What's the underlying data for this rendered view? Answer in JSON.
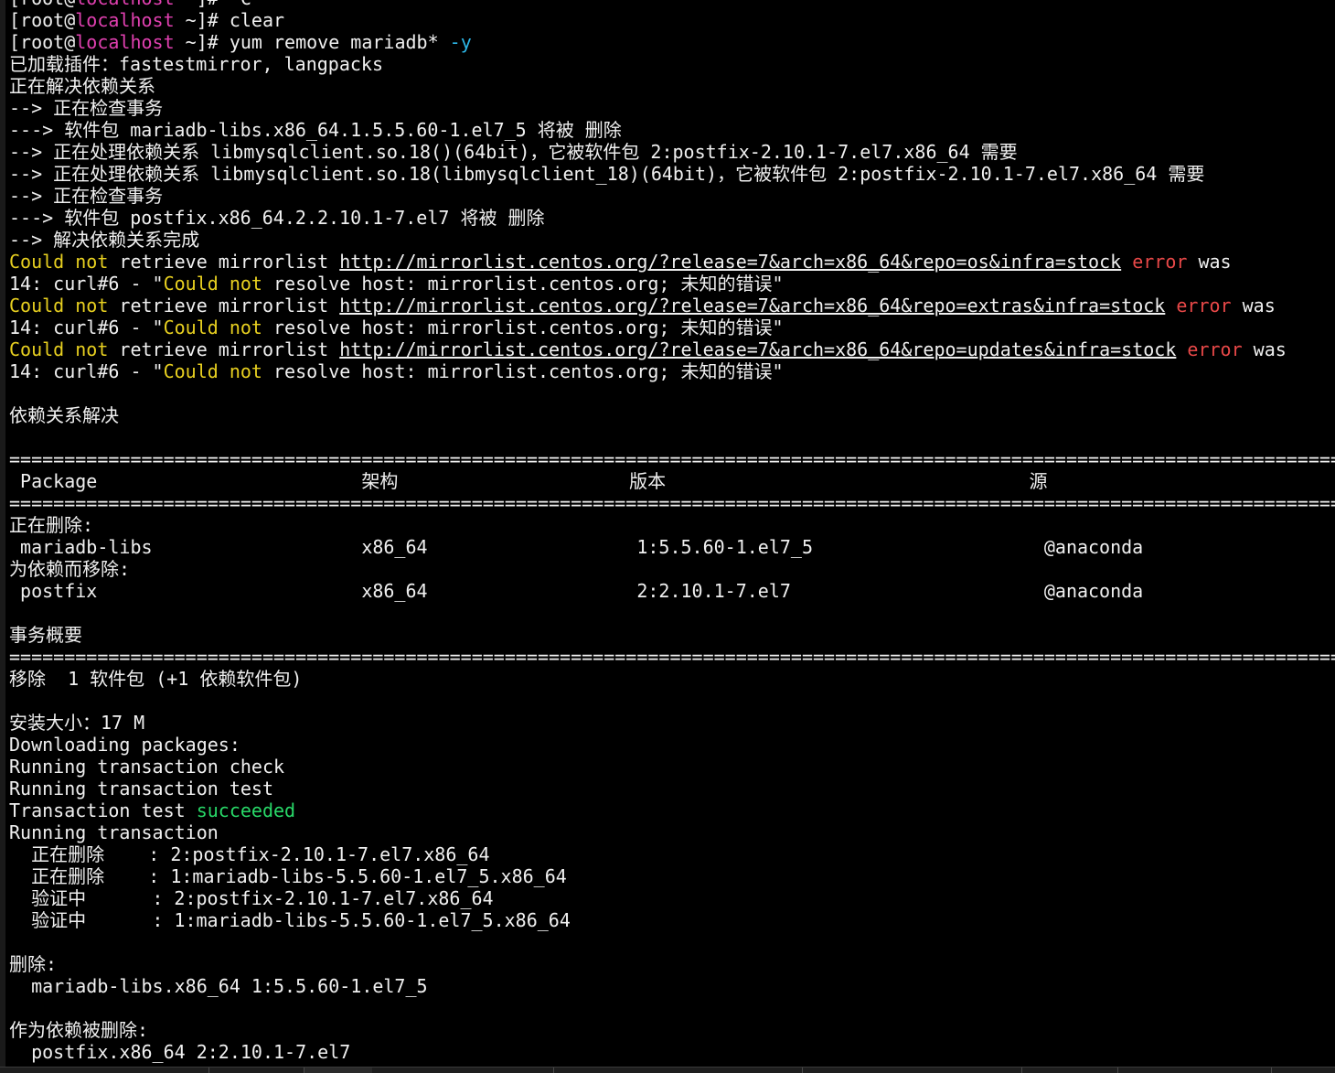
{
  "terminal": {
    "lines": [
      [
        {
          "t": "[root@",
          "c": "default"
        },
        {
          "t": "localhost",
          "c": "pink"
        },
        {
          "t": " ~]# ^C",
          "c": "default"
        }
      ],
      [
        {
          "t": "[root@",
          "c": "default"
        },
        {
          "t": "localhost",
          "c": "pink"
        },
        {
          "t": " ~]# clear",
          "c": "default"
        }
      ],
      [
        {
          "t": "[root@",
          "c": "default"
        },
        {
          "t": "localhost",
          "c": "pink"
        },
        {
          "t": " ~]# yum remove mariadb* ",
          "c": "default"
        },
        {
          "t": "-y",
          "c": "cyan"
        }
      ],
      [
        {
          "t": "已加载插件：fastestmirror, langpacks",
          "c": "default"
        }
      ],
      [
        {
          "t": "正在解决依赖关系",
          "c": "default"
        }
      ],
      [
        {
          "t": "--> 正在检查事务",
          "c": "default"
        }
      ],
      [
        {
          "t": "---> 软件包 mariadb-libs.x86_64.1.5.5.60-1.el7_5 将被 删除",
          "c": "default"
        }
      ],
      [
        {
          "t": "--> 正在处理依赖关系 libmysqlclient.so.18()(64bit)，它被软件包 2:postfix-2.10.1-7.el7.x86_64 需要",
          "c": "default"
        }
      ],
      [
        {
          "t": "--> 正在处理依赖关系 libmysqlclient.so.18(libmysqlclient_18)(64bit)，它被软件包 2:postfix-2.10.1-7.el7.x86_64 需要",
          "c": "default"
        }
      ],
      [
        {
          "t": "--> 正在检查事务",
          "c": "default"
        }
      ],
      [
        {
          "t": "---> 软件包 postfix.x86_64.2.2.10.1-7.el7 将被 删除",
          "c": "default"
        }
      ],
      [
        {
          "t": "--> 解决依赖关系完成",
          "c": "default"
        }
      ],
      [
        {
          "t": "Could not",
          "c": "yellow"
        },
        {
          "t": " retrieve mirrorlist ",
          "c": "default"
        },
        {
          "t": "http://mirrorlist.centos.org/?release=7&arch=x86_64&repo=os&infra=stock",
          "c": "link"
        },
        {
          "t": " ",
          "c": "default"
        },
        {
          "t": "error",
          "c": "red"
        },
        {
          "t": " was",
          "c": "default"
        }
      ],
      [
        {
          "t": "14: curl#6 - \"",
          "c": "default"
        },
        {
          "t": "Could not",
          "c": "yellow"
        },
        {
          "t": " resolve host: mirrorlist.centos.org; 未知的错误\"",
          "c": "default"
        }
      ],
      [
        {
          "t": "Could not",
          "c": "yellow"
        },
        {
          "t": " retrieve mirrorlist ",
          "c": "default"
        },
        {
          "t": "http://mirrorlist.centos.org/?release=7&arch=x86_64&repo=extras&infra=stock",
          "c": "link"
        },
        {
          "t": " ",
          "c": "default"
        },
        {
          "t": "error",
          "c": "red"
        },
        {
          "t": " was",
          "c": "default"
        }
      ],
      [
        {
          "t": "14: curl#6 - \"",
          "c": "default"
        },
        {
          "t": "Could not",
          "c": "yellow"
        },
        {
          "t": " resolve host: mirrorlist.centos.org; 未知的错误\"",
          "c": "default"
        }
      ],
      [
        {
          "t": "Could not",
          "c": "yellow"
        },
        {
          "t": " retrieve mirrorlist ",
          "c": "default"
        },
        {
          "t": "http://mirrorlist.centos.org/?release=7&arch=x86_64&repo=updates&infra=stock",
          "c": "link"
        },
        {
          "t": " ",
          "c": "default"
        },
        {
          "t": "error",
          "c": "red"
        },
        {
          "t": " was",
          "c": "default"
        }
      ],
      [
        {
          "t": "14: curl#6 - \"",
          "c": "default"
        },
        {
          "t": "Could not",
          "c": "yellow"
        },
        {
          "t": " resolve host: mirrorlist.centos.org; 未知的错误\"",
          "c": "default"
        }
      ],
      [],
      [
        {
          "t": "依赖关系解决",
          "c": "default"
        }
      ],
      [],
      [
        {
          "t": "==============================================================================================================================",
          "c": "default"
        }
      ],
      [
        {
          "t": " Package                        架构                     版本                                 源",
          "c": "default"
        }
      ],
      [
        {
          "t": "==============================================================================================================================",
          "c": "default"
        }
      ],
      [
        {
          "t": "正在删除:",
          "c": "default"
        }
      ],
      [
        {
          "t": " mariadb-libs                   x86_64                   1:5.5.60-1.el7_5                     @anaconda",
          "c": "default"
        }
      ],
      [
        {
          "t": "为依赖而移除:",
          "c": "default"
        }
      ],
      [
        {
          "t": " postfix                        x86_64                   2:2.10.1-7.el7                       @anaconda",
          "c": "default"
        }
      ],
      [],
      [
        {
          "t": "事务概要",
          "c": "default"
        }
      ],
      [
        {
          "t": "==============================================================================================================================",
          "c": "default"
        }
      ],
      [
        {
          "t": "移除  1 软件包 (+1 依赖软件包)",
          "c": "default"
        }
      ],
      [],
      [
        {
          "t": "安装大小：17 M",
          "c": "default"
        }
      ],
      [
        {
          "t": "Downloading packages:",
          "c": "default"
        }
      ],
      [
        {
          "t": "Running transaction check",
          "c": "default"
        }
      ],
      [
        {
          "t": "Running transaction test",
          "c": "default"
        }
      ],
      [
        {
          "t": "Transaction test ",
          "c": "default"
        },
        {
          "t": "succeeded",
          "c": "green"
        }
      ],
      [
        {
          "t": "Running transaction",
          "c": "default"
        }
      ],
      [
        {
          "t": "  正在删除    : 2:postfix-2.10.1-7.el7.x86_64",
          "c": "default"
        }
      ],
      [
        {
          "t": "  正在删除    : 1:mariadb-libs-5.5.60-1.el7_5.x86_64",
          "c": "default"
        }
      ],
      [
        {
          "t": "  验证中      : 2:postfix-2.10.1-7.el7.x86_64",
          "c": "default"
        }
      ],
      [
        {
          "t": "  验证中      : 1:mariadb-libs-5.5.60-1.el7_5.x86_64",
          "c": "default"
        }
      ],
      [],
      [
        {
          "t": "删除:",
          "c": "default"
        }
      ],
      [
        {
          "t": "  mariadb-libs.x86_64 1:5.5.60-1.el7_5",
          "c": "default"
        }
      ],
      [],
      [
        {
          "t": "作为依赖被删除:",
          "c": "default"
        }
      ],
      [
        {
          "t": "  postfix.x86_64 2:2.10.1-7.el7",
          "c": "default"
        }
      ]
    ]
  },
  "colors": {
    "background": "#000000",
    "foreground": "#f0f0f0",
    "hostname": "#e040b0",
    "option": "#2cb6e6",
    "warning": "#e8d020",
    "error": "#e84848",
    "success": "#28d868"
  }
}
